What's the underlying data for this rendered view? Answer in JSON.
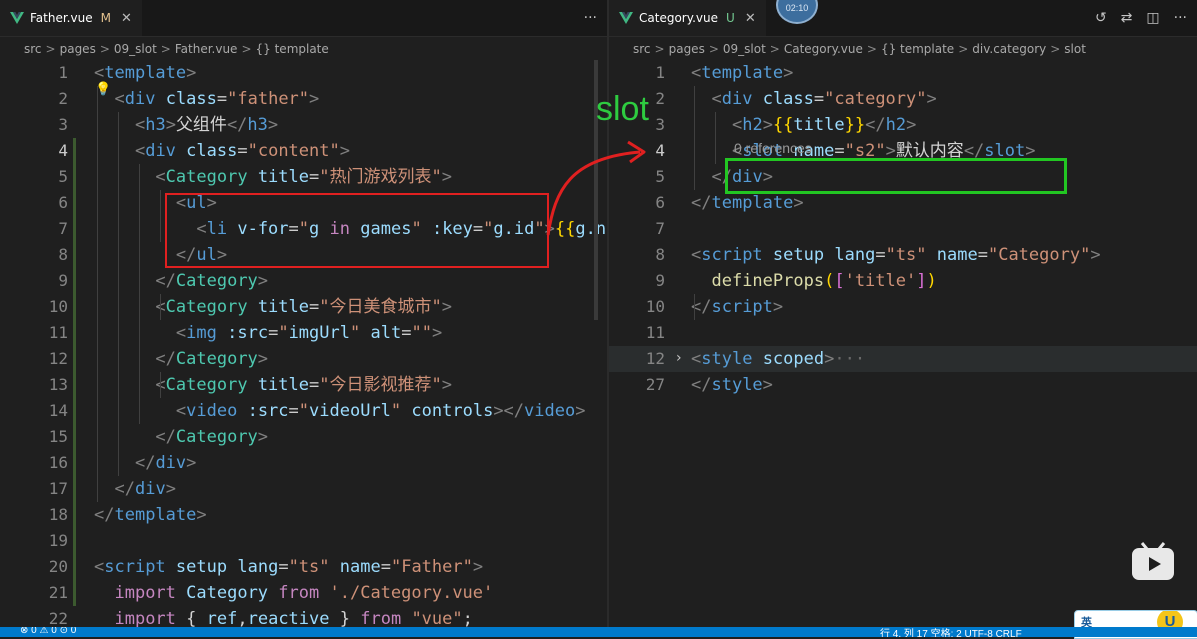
{
  "left_editor": {
    "tab": {
      "filename": "Father.vue",
      "status": "M"
    },
    "more_actions_icon": "ellipsis-icon",
    "breadcrumb": [
      "src",
      "pages",
      "09_slot",
      "Father.vue",
      "{} template"
    ],
    "active_line": "4",
    "lines": [
      {
        "n": "1",
        "tokens": [
          [
            "p",
            "<"
          ],
          [
            "tag",
            "template"
          ],
          [
            "p",
            ">"
          ]
        ]
      },
      {
        "n": "2",
        "tokens": [
          [
            "w",
            "  "
          ],
          [
            "p",
            "<"
          ],
          [
            "tag",
            "div"
          ],
          [
            "w",
            " "
          ],
          [
            "attr",
            "class"
          ],
          [
            "w",
            "="
          ],
          [
            "str",
            "\"father\""
          ],
          [
            "p",
            ">"
          ]
        ]
      },
      {
        "n": "3",
        "tokens": [
          [
            "w",
            "    "
          ],
          [
            "p",
            "<"
          ],
          [
            "tag",
            "h3"
          ],
          [
            "p",
            ">"
          ],
          [
            "text",
            "父组件"
          ],
          [
            "p",
            "</"
          ],
          [
            "tag",
            "h3"
          ],
          [
            "p",
            ">"
          ]
        ]
      },
      {
        "n": "4",
        "tokens": [
          [
            "w",
            "    "
          ],
          [
            "p",
            "<"
          ],
          [
            "tag",
            "div"
          ],
          [
            "w",
            " "
          ],
          [
            "attr",
            "class"
          ],
          [
            "w",
            "="
          ],
          [
            "str",
            "\"content\""
          ],
          [
            "p",
            ">"
          ]
        ]
      },
      {
        "n": "5",
        "tokens": [
          [
            "w",
            "      "
          ],
          [
            "p",
            "<"
          ],
          [
            "comp",
            "Category"
          ],
          [
            "w",
            " "
          ],
          [
            "attr",
            "title"
          ],
          [
            "w",
            "="
          ],
          [
            "str",
            "\"热门游戏列表\""
          ],
          [
            "p",
            ">"
          ]
        ]
      },
      {
        "n": "6",
        "tokens": [
          [
            "w",
            "        "
          ],
          [
            "p",
            "<"
          ],
          [
            "tag",
            "ul"
          ],
          [
            "p",
            ">"
          ]
        ]
      },
      {
        "n": "7",
        "tokens": [
          [
            "w",
            "          "
          ],
          [
            "p",
            "<"
          ],
          [
            "tag",
            "li"
          ],
          [
            "w",
            " "
          ],
          [
            "attr",
            "v-for"
          ],
          [
            "w",
            "="
          ],
          [
            "str",
            "\""
          ],
          [
            "attr",
            "g"
          ],
          [
            "w",
            " "
          ],
          [
            "kw",
            "in"
          ],
          [
            "w",
            " "
          ],
          [
            "attr",
            "games"
          ],
          [
            "str",
            "\""
          ],
          [
            "w",
            " "
          ],
          [
            "attr",
            ":key"
          ],
          [
            "w",
            "="
          ],
          [
            "str",
            "\""
          ],
          [
            "attr",
            "g.id"
          ],
          [
            "str",
            "\""
          ],
          [
            "p",
            ">"
          ],
          [
            "br",
            "{{"
          ],
          [
            "attr",
            "g.name"
          ],
          [
            "br",
            "}}"
          ]
        ]
      },
      {
        "n": "8",
        "tokens": [
          [
            "w",
            "        "
          ],
          [
            "p",
            "</"
          ],
          [
            "tag",
            "ul"
          ],
          [
            "p",
            ">"
          ]
        ]
      },
      {
        "n": "9",
        "tokens": [
          [
            "w",
            "      "
          ],
          [
            "p",
            "</"
          ],
          [
            "comp",
            "Category"
          ],
          [
            "p",
            ">"
          ]
        ]
      },
      {
        "n": "10",
        "tokens": [
          [
            "w",
            "      "
          ],
          [
            "p",
            "<"
          ],
          [
            "comp",
            "Category"
          ],
          [
            "w",
            " "
          ],
          [
            "attr",
            "title"
          ],
          [
            "w",
            "="
          ],
          [
            "str",
            "\"今日美食城市\""
          ],
          [
            "p",
            ">"
          ]
        ]
      },
      {
        "n": "11",
        "tokens": [
          [
            "w",
            "        "
          ],
          [
            "p",
            "<"
          ],
          [
            "tag",
            "img"
          ],
          [
            "w",
            " "
          ],
          [
            "attr",
            ":src"
          ],
          [
            "w",
            "="
          ],
          [
            "str",
            "\""
          ],
          [
            "attr",
            "imgUrl"
          ],
          [
            "str",
            "\""
          ],
          [
            "w",
            " "
          ],
          [
            "attr",
            "alt"
          ],
          [
            "w",
            "="
          ],
          [
            "str",
            "\"\""
          ],
          [
            "p",
            ">"
          ]
        ]
      },
      {
        "n": "12",
        "tokens": [
          [
            "w",
            "      "
          ],
          [
            "p",
            "</"
          ],
          [
            "comp",
            "Category"
          ],
          [
            "p",
            ">"
          ]
        ]
      },
      {
        "n": "13",
        "tokens": [
          [
            "w",
            "      "
          ],
          [
            "p",
            "<"
          ],
          [
            "comp",
            "Category"
          ],
          [
            "w",
            " "
          ],
          [
            "attr",
            "title"
          ],
          [
            "w",
            "="
          ],
          [
            "str",
            "\"今日影视推荐\""
          ],
          [
            "p",
            ">"
          ]
        ]
      },
      {
        "n": "14",
        "tokens": [
          [
            "w",
            "        "
          ],
          [
            "p",
            "<"
          ],
          [
            "tag",
            "video"
          ],
          [
            "w",
            " "
          ],
          [
            "attr",
            ":src"
          ],
          [
            "w",
            "="
          ],
          [
            "str",
            "\""
          ],
          [
            "attr",
            "videoUrl"
          ],
          [
            "str",
            "\""
          ],
          [
            "w",
            " "
          ],
          [
            "attr",
            "controls"
          ],
          [
            "p",
            "></"
          ],
          [
            "tag",
            "video"
          ],
          [
            "p",
            ">"
          ]
        ]
      },
      {
        "n": "15",
        "tokens": [
          [
            "w",
            "      "
          ],
          [
            "p",
            "</"
          ],
          [
            "comp",
            "Category"
          ],
          [
            "p",
            ">"
          ]
        ]
      },
      {
        "n": "16",
        "tokens": [
          [
            "w",
            "    "
          ],
          [
            "p",
            "</"
          ],
          [
            "tag",
            "div"
          ],
          [
            "p",
            ">"
          ]
        ]
      },
      {
        "n": "17",
        "tokens": [
          [
            "w",
            "  "
          ],
          [
            "p",
            "</"
          ],
          [
            "tag",
            "div"
          ],
          [
            "p",
            ">"
          ]
        ]
      },
      {
        "n": "18",
        "tokens": [
          [
            "p",
            "</"
          ],
          [
            "tag",
            "template"
          ],
          [
            "p",
            ">"
          ]
        ]
      },
      {
        "n": "19",
        "tokens": []
      },
      {
        "n": "20",
        "tokens": [
          [
            "p",
            "<"
          ],
          [
            "tag",
            "script"
          ],
          [
            "w",
            " "
          ],
          [
            "attr",
            "setup"
          ],
          [
            "w",
            " "
          ],
          [
            "attr",
            "lang"
          ],
          [
            "w",
            "="
          ],
          [
            "str",
            "\"ts\""
          ],
          [
            "w",
            " "
          ],
          [
            "attr",
            "name"
          ],
          [
            "w",
            "="
          ],
          [
            "str",
            "\"Father\""
          ],
          [
            "p",
            ">"
          ]
        ]
      },
      {
        "n": "21",
        "tokens": [
          [
            "w",
            "  "
          ],
          [
            "kw",
            "import"
          ],
          [
            "w",
            " "
          ],
          [
            "attr",
            "Category"
          ],
          [
            "w",
            " "
          ],
          [
            "kw",
            "from"
          ],
          [
            "w",
            " "
          ],
          [
            "str",
            "'./Category.vue'"
          ]
        ]
      },
      {
        "n": "22",
        "tokens": [
          [
            "w",
            "  "
          ],
          [
            "kw",
            "import"
          ],
          [
            "w",
            " "
          ],
          [
            "text",
            "{ "
          ],
          [
            "attr",
            "ref"
          ],
          [
            "text",
            ","
          ],
          [
            "attr",
            "reactive"
          ],
          [
            "text",
            " }"
          ],
          [
            "w",
            " "
          ],
          [
            "kw",
            "from"
          ],
          [
            "w",
            " "
          ],
          [
            "str",
            "\"vue\""
          ],
          [
            "text",
            ";"
          ]
        ]
      }
    ]
  },
  "right_editor": {
    "tab": {
      "filename": "Category.vue",
      "status": "U"
    },
    "tab_actions": [
      "history-icon",
      "compare-changes-icon",
      "split-editor-icon",
      "ellipsis-icon"
    ],
    "breadcrumb": [
      "src",
      "pages",
      "09_slot",
      "Category.vue",
      "{} template",
      "div.category",
      "slot"
    ],
    "active_line": "4",
    "codelens": "0 references",
    "lines": [
      {
        "n": "1",
        "tokens": [
          [
            "p",
            "<"
          ],
          [
            "tag",
            "template"
          ],
          [
            "p",
            ">"
          ]
        ]
      },
      {
        "n": "2",
        "tokens": [
          [
            "w",
            "  "
          ],
          [
            "p",
            "<"
          ],
          [
            "tag",
            "div"
          ],
          [
            "w",
            " "
          ],
          [
            "attr",
            "class"
          ],
          [
            "w",
            "="
          ],
          [
            "str",
            "\"category\""
          ],
          [
            "p",
            ">"
          ]
        ]
      },
      {
        "n": "3",
        "tokens": [
          [
            "w",
            "    "
          ],
          [
            "p",
            "<"
          ],
          [
            "tag",
            "h2"
          ],
          [
            "p",
            ">"
          ],
          [
            "br",
            "{{"
          ],
          [
            "attr",
            "title"
          ],
          [
            "br",
            "}}"
          ],
          [
            "p",
            "</"
          ],
          [
            "tag",
            "h2"
          ],
          [
            "p",
            ">"
          ]
        ]
      },
      {
        "n": "4",
        "tokens": [
          [
            "w",
            "    "
          ],
          [
            "p",
            "<"
          ],
          [
            "tag",
            "slot"
          ],
          [
            "w",
            " "
          ],
          [
            "attr",
            "name"
          ],
          [
            "w",
            "="
          ],
          [
            "str",
            "\"s2\""
          ],
          [
            "p",
            ">"
          ],
          [
            "text",
            "默认内容"
          ],
          [
            "p",
            "</"
          ],
          [
            "tag",
            "slot"
          ],
          [
            "p",
            ">"
          ]
        ]
      },
      {
        "n": "5",
        "tokens": [
          [
            "w",
            "  "
          ],
          [
            "p",
            "</"
          ],
          [
            "tag",
            "div"
          ],
          [
            "p",
            ">"
          ]
        ]
      },
      {
        "n": "6",
        "tokens": [
          [
            "p",
            "</"
          ],
          [
            "tag",
            "template"
          ],
          [
            "p",
            ">"
          ]
        ]
      },
      {
        "n": "7",
        "tokens": []
      },
      {
        "n": "8",
        "tokens": [
          [
            "p",
            "<"
          ],
          [
            "tag",
            "script"
          ],
          [
            "w",
            " "
          ],
          [
            "attr",
            "setup"
          ],
          [
            "w",
            " "
          ],
          [
            "attr",
            "lang"
          ],
          [
            "w",
            "="
          ],
          [
            "str",
            "\"ts\""
          ],
          [
            "w",
            " "
          ],
          [
            "attr",
            "name"
          ],
          [
            "w",
            "="
          ],
          [
            "str",
            "\"Category\""
          ],
          [
            "p",
            ">"
          ]
        ]
      },
      {
        "n": "9",
        "tokens": [
          [
            "w",
            "  "
          ],
          [
            "fn",
            "defineProps"
          ],
          [
            "br",
            "("
          ],
          [
            "br2",
            "["
          ],
          [
            "str",
            "'title'"
          ],
          [
            "br2",
            "]"
          ],
          [
            "br",
            ")"
          ]
        ]
      },
      {
        "n": "10",
        "tokens": [
          [
            "p",
            "</"
          ],
          [
            "tag",
            "script"
          ],
          [
            "p",
            ">"
          ]
        ]
      },
      {
        "n": "11",
        "tokens": []
      },
      {
        "n": "12",
        "tokens": [
          [
            "p",
            "<"
          ],
          [
            "tag",
            "style"
          ],
          [
            "w",
            " "
          ],
          [
            "attr",
            "scoped"
          ],
          [
            "p",
            ">"
          ],
          [
            "dim",
            "···"
          ]
        ]
      },
      {
        "n": "27",
        "tokens": [
          [
            "p",
            "</"
          ],
          [
            "tag",
            "style"
          ],
          [
            "p",
            ">"
          ]
        ]
      }
    ]
  },
  "annotation": {
    "label": "slot"
  },
  "overlay": {
    "timer": "02:10"
  },
  "ime": {
    "lang": "英"
  },
  "status_bar": {
    "left": "⊗ 0 ⚠ 0  ⊙ 0",
    "right": "行 4, 列 17  空格: 2  UTF-8  CRLF"
  },
  "colors": {
    "accent": "#007acc",
    "annotation_red": "#e02020",
    "annotation_green": "#22c622"
  }
}
